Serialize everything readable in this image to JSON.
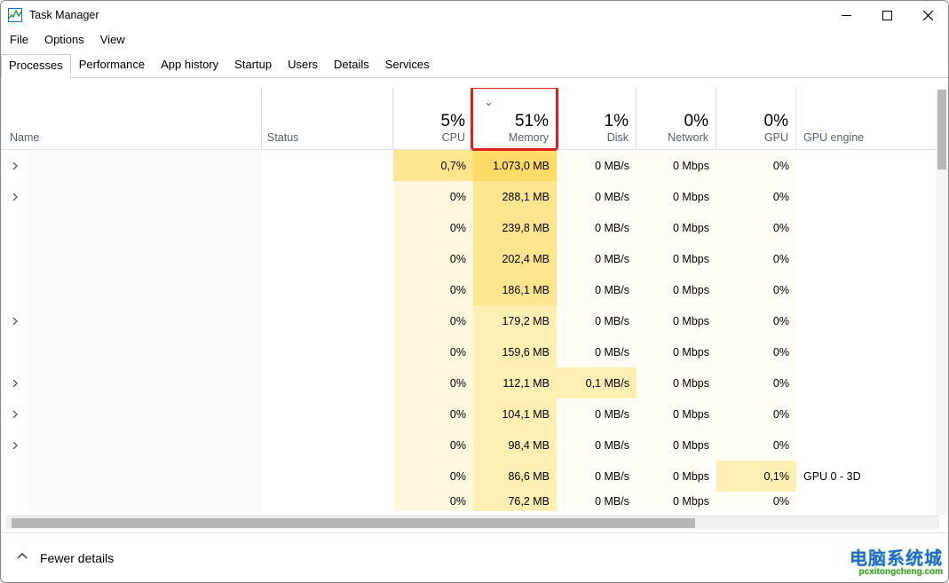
{
  "window": {
    "title": "Task Manager"
  },
  "menu": {
    "file": "File",
    "options": "Options",
    "view": "View"
  },
  "tabs": {
    "processes": "Processes",
    "performance": "Performance",
    "app_history": "App history",
    "startup": "Startup",
    "users": "Users",
    "details": "Details",
    "services": "Services"
  },
  "headers": {
    "name": "Name",
    "status": "Status",
    "cpu_pct": "5%",
    "cpu_lbl": "CPU",
    "mem_pct": "51%",
    "mem_lbl": "Memory",
    "disk_pct": "1%",
    "disk_lbl": "Disk",
    "net_pct": "0%",
    "net_lbl": "Network",
    "gpu_pct": "0%",
    "gpu_lbl": "GPU",
    "gpu_engine": "GPU engine"
  },
  "rows": [
    {
      "expand": true,
      "cpu": "0,7%",
      "mem": "1.073,0 MB",
      "disk": "0 MB/s",
      "net": "0 Mbps",
      "gpu": "0%",
      "gpuengine": ""
    },
    {
      "expand": true,
      "cpu": "0%",
      "mem": "288,1 MB",
      "disk": "0 MB/s",
      "net": "0 Mbps",
      "gpu": "0%",
      "gpuengine": ""
    },
    {
      "expand": false,
      "cpu": "0%",
      "mem": "239,8 MB",
      "disk": "0 MB/s",
      "net": "0 Mbps",
      "gpu": "0%",
      "gpuengine": ""
    },
    {
      "expand": false,
      "cpu": "0%",
      "mem": "202,4 MB",
      "disk": "0 MB/s",
      "net": "0 Mbps",
      "gpu": "0%",
      "gpuengine": ""
    },
    {
      "expand": false,
      "cpu": "0%",
      "mem": "186,1 MB",
      "disk": "0 MB/s",
      "net": "0 Mbps",
      "gpu": "0%",
      "gpuengine": ""
    },
    {
      "expand": true,
      "cpu": "0%",
      "mem": "179,2 MB",
      "disk": "0 MB/s",
      "net": "0 Mbps",
      "gpu": "0%",
      "gpuengine": ""
    },
    {
      "expand": false,
      "cpu": "0%",
      "mem": "159,6 MB",
      "disk": "0 MB/s",
      "net": "0 Mbps",
      "gpu": "0%",
      "gpuengine": ""
    },
    {
      "expand": true,
      "cpu": "0%",
      "mem": "112,1 MB",
      "disk": "0,1 MB/s",
      "net": "0 Mbps",
      "gpu": "0%",
      "gpuengine": ""
    },
    {
      "expand": true,
      "cpu": "0%",
      "mem": "104,1 MB",
      "disk": "0 MB/s",
      "net": "0 Mbps",
      "gpu": "0%",
      "gpuengine": ""
    },
    {
      "expand": true,
      "cpu": "0%",
      "mem": "98,4 MB",
      "disk": "0 MB/s",
      "net": "0 Mbps",
      "gpu": "0%",
      "gpuengine": ""
    },
    {
      "expand": false,
      "cpu": "0%",
      "mem": "86,6 MB",
      "disk": "0 MB/s",
      "net": "0 Mbps",
      "gpu": "0,1%",
      "gpuengine": "GPU 0 - 3D"
    },
    {
      "expand": false,
      "cpu": "0%",
      "mem": "76,2 MB",
      "disk": "0 MB/s",
      "net": "0 Mbps",
      "gpu": "0%",
      "gpuengine": ""
    }
  ],
  "footer": {
    "fewer_details": "Fewer details"
  },
  "watermark": {
    "line1": "电脑系统城",
    "line2": "pcxitongcheng.com"
  }
}
